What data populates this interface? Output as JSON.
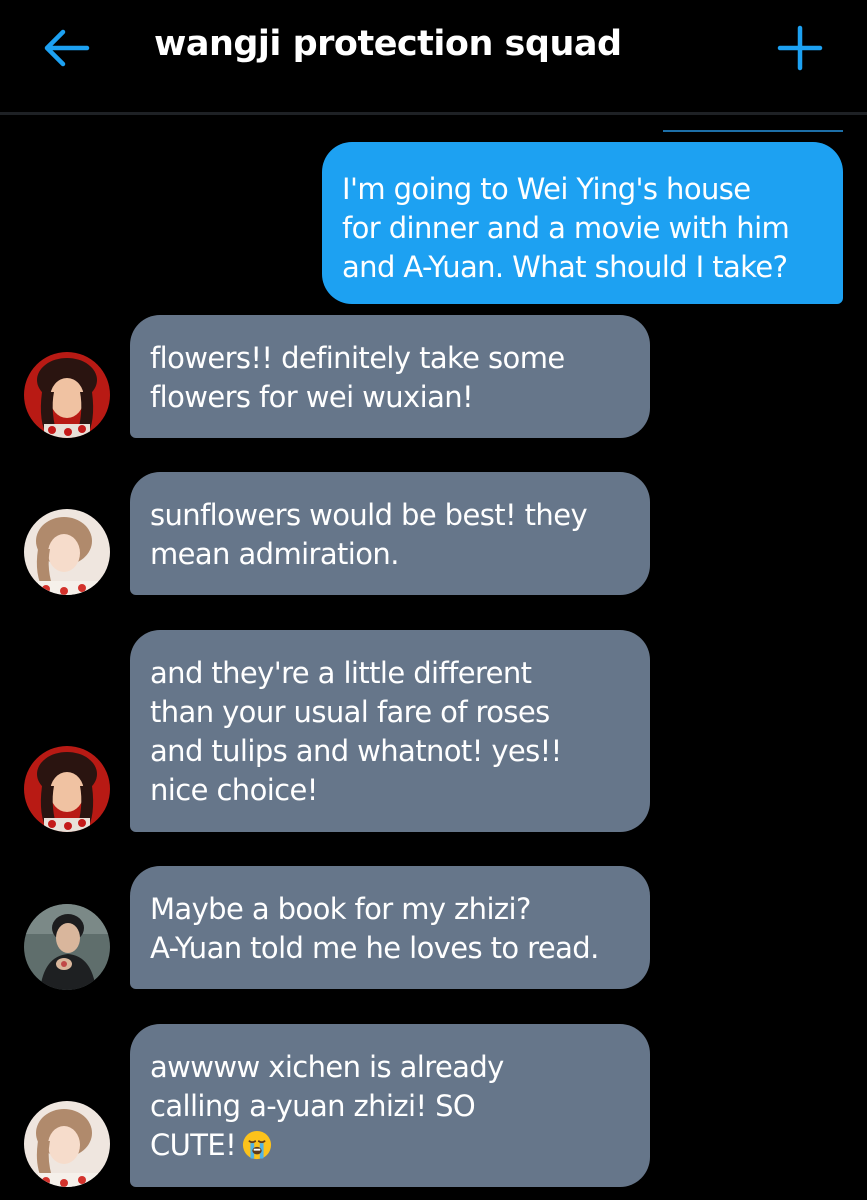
{
  "header": {
    "title": "wangji protection squad",
    "back_icon": "arrow-left-icon",
    "add_icon": "plus-icon",
    "accent_color": "#1da1f2"
  },
  "messages": [
    {
      "type": "sent",
      "text": "I'm going to Wei Ying's house\nfor dinner and a movie with him\nand A-Yuan. What should I take?"
    },
    {
      "type": "received",
      "avatar": "avatar-red-hair-ornament",
      "text": "flowers!! definitely take some\nflowers for wei wuxian!"
    },
    {
      "type": "received",
      "avatar": "avatar-light-portrait",
      "text": "sunflowers would be best! they\nmean admiration."
    },
    {
      "type": "received",
      "avatar": "avatar-red-hair-ornament",
      "text": "and they're a little different\nthan your usual fare of roses\nand tulips and whatnot! yes!!\nnice choice!"
    },
    {
      "type": "received",
      "avatar": "avatar-man-dark",
      "text": "Maybe a book for my zhizi?\nA-Yuan told me he loves to read."
    },
    {
      "type": "received",
      "avatar": "avatar-light-portrait",
      "text": "awwww xichen is already\ncalling a-yuan zhizi! SO\nCUTE!",
      "emoji": "crying-face-emoji"
    }
  ],
  "colors": {
    "background": "#000000",
    "sent_bubble": "#1da1f2",
    "received_bubble": "#66768a"
  }
}
